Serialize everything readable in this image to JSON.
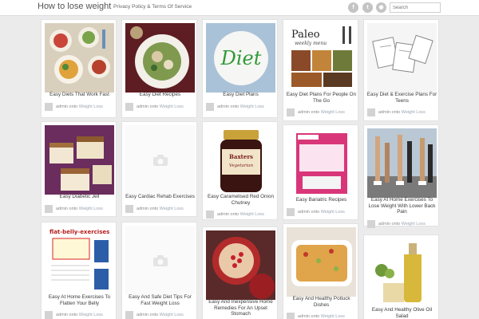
{
  "header": {
    "site_title": "How to lose weight",
    "nav_link": "Privacy Policy & Terms Of Service",
    "social": [
      {
        "name": "facebook-icon",
        "glyph": "f"
      },
      {
        "name": "twitter-icon",
        "glyph": "t"
      },
      {
        "name": "rss-icon",
        "glyph": "◉"
      }
    ],
    "search_placeholder": "Search"
  },
  "posts": [
    {
      "title": "Easy Diets That Work Fast",
      "author": "admin",
      "prep": "onto",
      "category": "Weight Loss",
      "image": "diet-plates-photo"
    },
    {
      "title": "Easy Diet Recipes",
      "author": "admin",
      "prep": "onto",
      "category": "Weight Loss",
      "image": "salad-bowl-photo"
    },
    {
      "title": "Easy Diet Plans",
      "author": "admin",
      "prep": "onto",
      "category": "Weight Loss",
      "image": "diet-word-plate-photo"
    },
    {
      "title": "Easy Diet Plans For People On The Go",
      "author": "admin",
      "prep": "onto",
      "category": "Weight Loss",
      "image": "paleo-menu-photo",
      "overlay_text": "Paleo weekly menu"
    },
    {
      "title": "Easy Diet & Exercise Plans For Teens",
      "author": "admin",
      "prep": "onto",
      "category": "Weight Loss",
      "image": "booklet-photo"
    },
    {
      "title": "Easy Diabetic Jell",
      "author": "admin",
      "prep": "onto",
      "category": "Weight Loss",
      "image": "fudge-photo"
    },
    {
      "title": "Easy Cardiac Rehab Exercises",
      "author": "admin",
      "prep": "onto",
      "category": "Weight Loss",
      "image": "camera-placeholder"
    },
    {
      "title": "Easy Caramelised Red Onion Chutney",
      "author": "admin",
      "prep": "onto",
      "category": "Weight Loss",
      "image": "chutney-jar-photo",
      "overlay_text": "Baxters Vegetarian"
    },
    {
      "title": "Easy Bariatric Recipes",
      "author": "admin",
      "prep": "onto",
      "category": "Weight Loss",
      "image": "snack-bag-photo"
    },
    {
      "title": "Easy At Home Exercises To Lose Weight With Lower Back Pain",
      "author": "admin",
      "prep": "onto",
      "category": "Weight Loss",
      "image": "runners-legs-photo"
    },
    {
      "title": "Easy At Home Exercises To Flatten Your Belly",
      "author": "admin",
      "prep": "onto",
      "category": "Weight Loss",
      "image": "flat-belly-page-photo",
      "overlay_text": "flat-belly-exercises"
    },
    {
      "title": "Easy And Safe Diet Tips For Fast Weight Loss",
      "author": "admin",
      "prep": "onto",
      "category": "Weight Loss",
      "image": "camera-placeholder"
    },
    {
      "title": "Easy And Inexpensive Home Remedies For An Upset Stomach",
      "author": "admin",
      "prep": "onto",
      "category": "Weight Loss",
      "image": "pomegranate-photo"
    },
    {
      "title": "Easy And Healthy Potluck Dishes",
      "author": "admin",
      "prep": "onto",
      "category": "Weight Loss",
      "image": "casserole-photo"
    },
    {
      "title": "Easy And Healthy Olive Oil Salad",
      "author": "admin",
      "prep": "onto",
      "category": "Weight Loss",
      "image": "olive-oil-photo"
    }
  ]
}
